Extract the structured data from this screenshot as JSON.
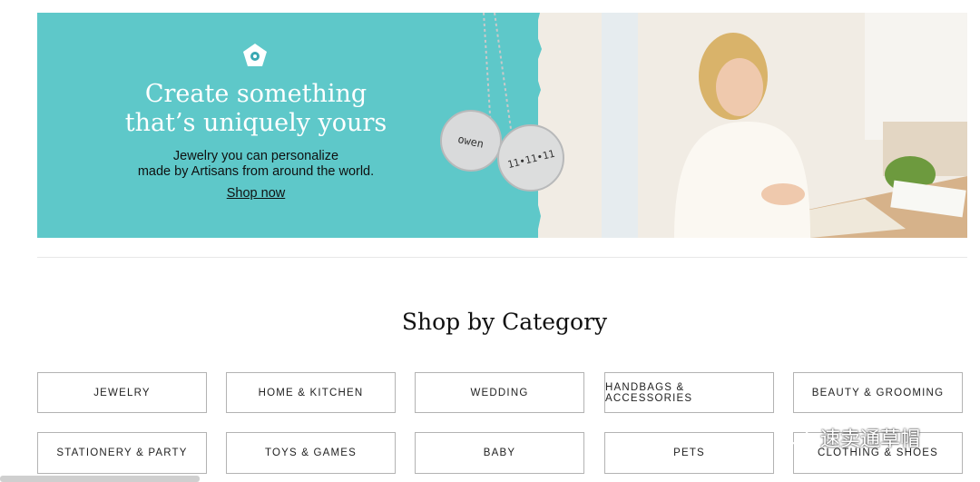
{
  "hero": {
    "headline_line1": "Create something",
    "headline_line2": "that’s uniquely yours",
    "sub_line1": "Jewelry you can personalize",
    "sub_line2": "made by Artisans from around the world.",
    "cta": "Shop now",
    "pendant1_text": "owen",
    "pendant2_text": "11•11•11",
    "colors": {
      "banner": "#5ec8c9",
      "headline": "#ffffff"
    }
  },
  "section_title": "Shop by Category",
  "categories": [
    "JEWELRY",
    "HOME & KITCHEN",
    "WEDDING",
    "HANDBAGS & ACCESSORIES",
    "BEAUTY & GROOMING",
    "STATIONERY & PARTY",
    "TOYS & GAMES",
    "BABY",
    "PETS",
    "CLOTHING & SHOES"
  ],
  "watermark": "速卖通草帽"
}
